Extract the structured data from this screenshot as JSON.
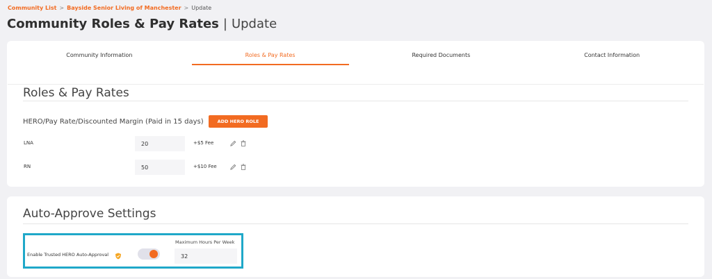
{
  "breadcrumb": {
    "items": [
      "Community List",
      "Bayside Senior Living of Manchester"
    ],
    "separator": ">",
    "current": "Update"
  },
  "page_title": {
    "main": "Community Roles & Pay Rates",
    "separator": "|",
    "sub": "Update"
  },
  "tabs": [
    {
      "label": "Community Information",
      "active": false
    },
    {
      "label": "Roles & Pay Rates",
      "active": true
    },
    {
      "label": "Required Documents",
      "active": false
    },
    {
      "label": "Contact Information",
      "active": false
    }
  ],
  "roles_section": {
    "title": "Roles & Pay Rates",
    "hero_label": "HERO/Pay Rate/Discounted Margin (Paid in 15 days)",
    "add_button": "ADD HERO ROLE",
    "roles": [
      {
        "name": "LNA",
        "rate": "20",
        "fee": "+$5 Fee"
      },
      {
        "name": "RN",
        "rate": "50",
        "fee": "+$10 Fee"
      }
    ]
  },
  "auto_section": {
    "title": "Auto-Approve Settings",
    "trusted_label": "Enable Trusted HERO Auto-Approval",
    "toggle_on": true,
    "max_hours_label": "Maximum Hours Per Week",
    "max_hours_value": "32"
  },
  "colors": {
    "accent": "#f26b21",
    "highlight_border": "#1fa8c9"
  },
  "icons": {
    "edit": "pencil-icon",
    "delete": "trash-icon",
    "badge": "shield-icon"
  }
}
